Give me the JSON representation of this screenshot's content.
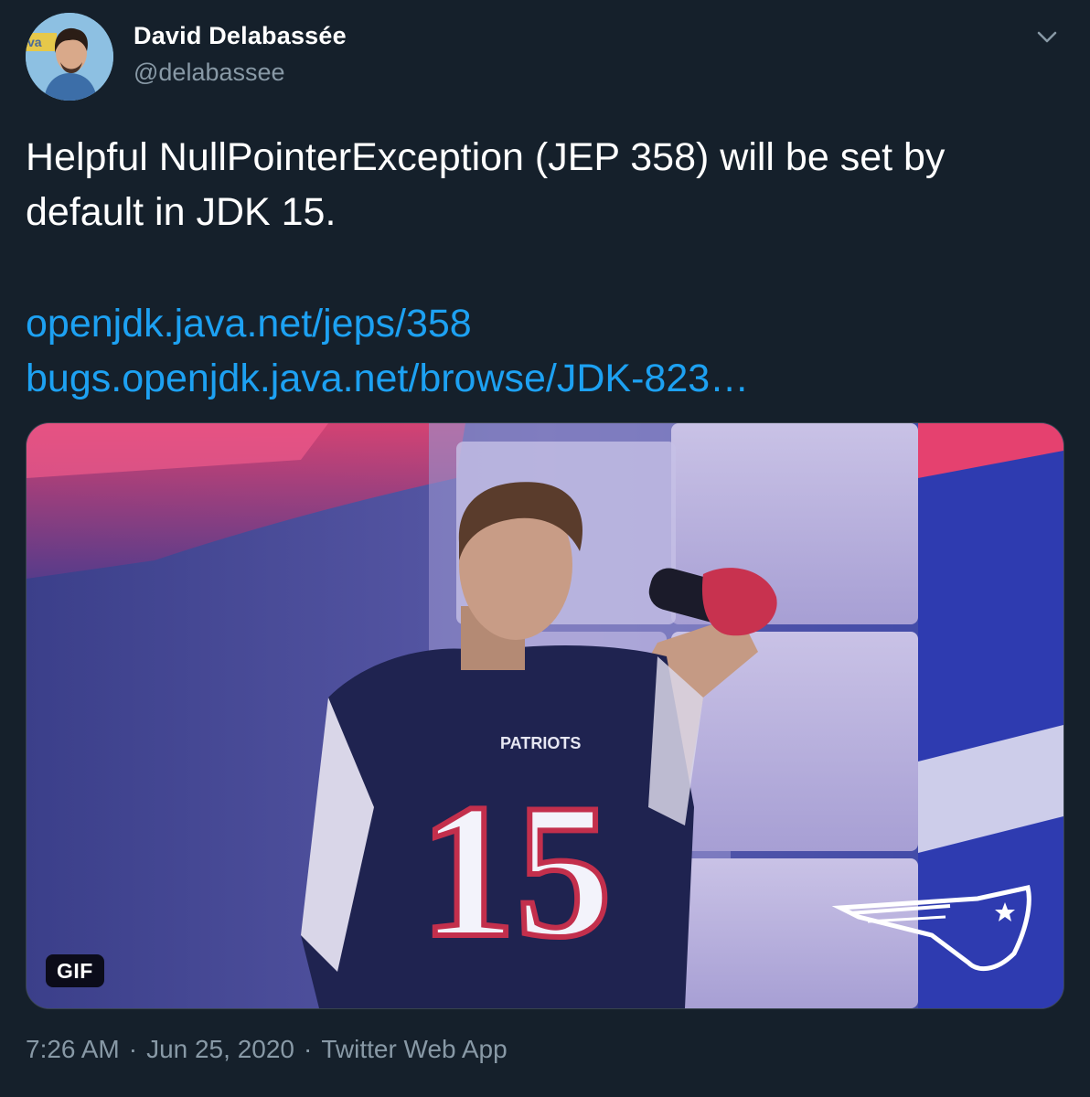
{
  "author": {
    "display_name": "David Delabassée",
    "handle": "@delabassee",
    "avatar_icon": "profile-photo"
  },
  "menu_icon": "chevron-down-icon",
  "tweet": {
    "text": "Helpful NullPointerException (JEP 358) will be set by default in JDK 15.",
    "links": [
      "openjdk.java.net/jeps/358",
      "bugs.openjdk.java.net/browse/JDK-823…"
    ]
  },
  "media": {
    "badge": "GIF",
    "jersey_text": "PATRIOTS",
    "jersey_number": "15"
  },
  "meta": {
    "time": "7:26 AM",
    "separator": "·",
    "date": "Jun 25, 2020",
    "source": "Twitter Web App"
  },
  "colors": {
    "background": "#15202b",
    "link": "#1da1f2",
    "secondary_text": "#8899a6",
    "border": "#38444d"
  }
}
